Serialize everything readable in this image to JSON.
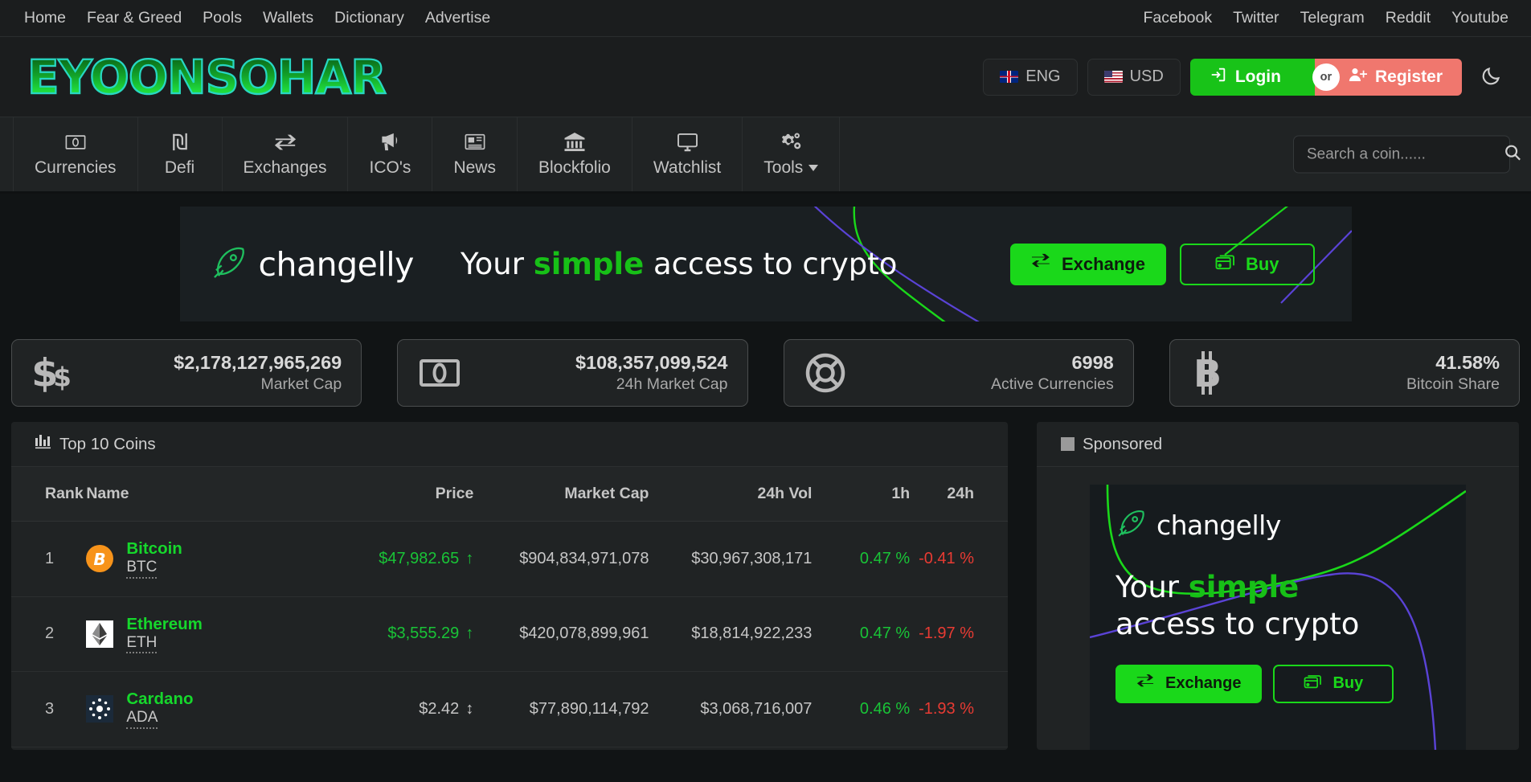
{
  "topbar": {
    "left_links": [
      "Home",
      "Fear & Greed",
      "Pools",
      "Wallets",
      "Dictionary",
      "Advertise"
    ],
    "right_links": [
      "Facebook",
      "Twitter",
      "Telegram",
      "Reddit",
      "Youtube"
    ]
  },
  "header": {
    "logo_text": "EYOONSOHAR",
    "language": "ENG",
    "currency": "USD",
    "login_label": "Login",
    "or_label": "or",
    "register_label": "Register",
    "theme_icon": "moon-icon"
  },
  "mainnav": {
    "items": [
      {
        "label": "Currencies",
        "icon": "money-bill-icon"
      },
      {
        "label": "Defi",
        "icon": "shekel-sign-icon"
      },
      {
        "label": "Exchanges",
        "icon": "exchange-arrows-icon"
      },
      {
        "label": "ICO's",
        "icon": "bullhorn-icon"
      },
      {
        "label": "News",
        "icon": "newspaper-icon"
      },
      {
        "label": "Blockfolio",
        "icon": "bank-icon"
      },
      {
        "label": "Watchlist",
        "icon": "desktop-icon"
      },
      {
        "label": "Tools",
        "icon": "gears-icon",
        "has_caret": true
      }
    ],
    "search_placeholder": "Search a coin......"
  },
  "banner": {
    "brand": "changelly",
    "tagline_pre": "Your ",
    "tagline_accent": "simple",
    "tagline_post": " access to crypto",
    "exchange_label": "Exchange",
    "buy_label": "Buy",
    "accent_green": "#1ad81a",
    "accent_purple": "#5a43d6"
  },
  "stats": [
    {
      "value": "$2,178,127,965,269",
      "label": "Market Cap",
      "icon": "dollar-signs-icon"
    },
    {
      "value": "$108,357,099,524",
      "label": "24h Market Cap",
      "icon": "money-bill-icon"
    },
    {
      "value": "6998",
      "label": "Active Currencies",
      "icon": "lifering-icon"
    },
    {
      "value": "41.58%",
      "label": "Bitcoin Share",
      "icon": "bitcoin-icon"
    }
  ],
  "top_coins": {
    "title": "Top 10 Coins",
    "title_icon": "chart-bar-icon",
    "columns": [
      "Rank",
      "Name",
      "Price",
      "Market Cap",
      "24h Vol",
      "1h",
      "24h"
    ],
    "rows": [
      {
        "rank": "1",
        "name": "Bitcoin",
        "symbol": "BTC",
        "price": "$47,982.65",
        "price_trend": "up",
        "market_cap": "$904,834,971,078",
        "vol_24h": "$30,967,308,171",
        "change_1h": "0.47 %",
        "change_1h_dir": "up",
        "change_24h": "-0.41 %",
        "change_24h_dir": "down"
      },
      {
        "rank": "2",
        "name": "Ethereum",
        "symbol": "ETH",
        "price": "$3,555.29",
        "price_trend": "up",
        "market_cap": "$420,078,899,961",
        "vol_24h": "$18,814,922,233",
        "change_1h": "0.47 %",
        "change_1h_dir": "up",
        "change_24h": "-1.97 %",
        "change_24h_dir": "down"
      },
      {
        "rank": "3",
        "name": "Cardano",
        "symbol": "ADA",
        "price": "$2.42",
        "price_trend": "flat",
        "market_cap": "$77,890,114,792",
        "vol_24h": "$3,068,716,007",
        "change_1h": "0.46 %",
        "change_1h_dir": "up",
        "change_24h": "-1.93 %",
        "change_24h_dir": "down"
      }
    ]
  },
  "sponsored": {
    "title": "Sponsored",
    "title_icon": "square-icon",
    "ad": {
      "brand": "changelly",
      "tagline_pre": "Your ",
      "tagline_accent": "simple",
      "tagline_post": "access to crypto",
      "exchange_label": "Exchange",
      "buy_label": "Buy"
    }
  }
}
